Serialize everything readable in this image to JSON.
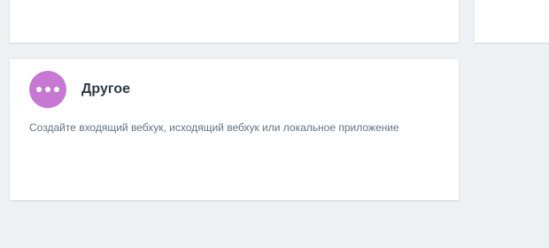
{
  "cards": {
    "other": {
      "title": "Другое",
      "description": "Создайте входящий вебхук, исходящий вебхук или локальное приложение",
      "icon": "more-dots-icon",
      "icon_color": "#c678d3"
    }
  },
  "colors": {
    "background": "#eef1f4",
    "card": "#ffffff"
  }
}
